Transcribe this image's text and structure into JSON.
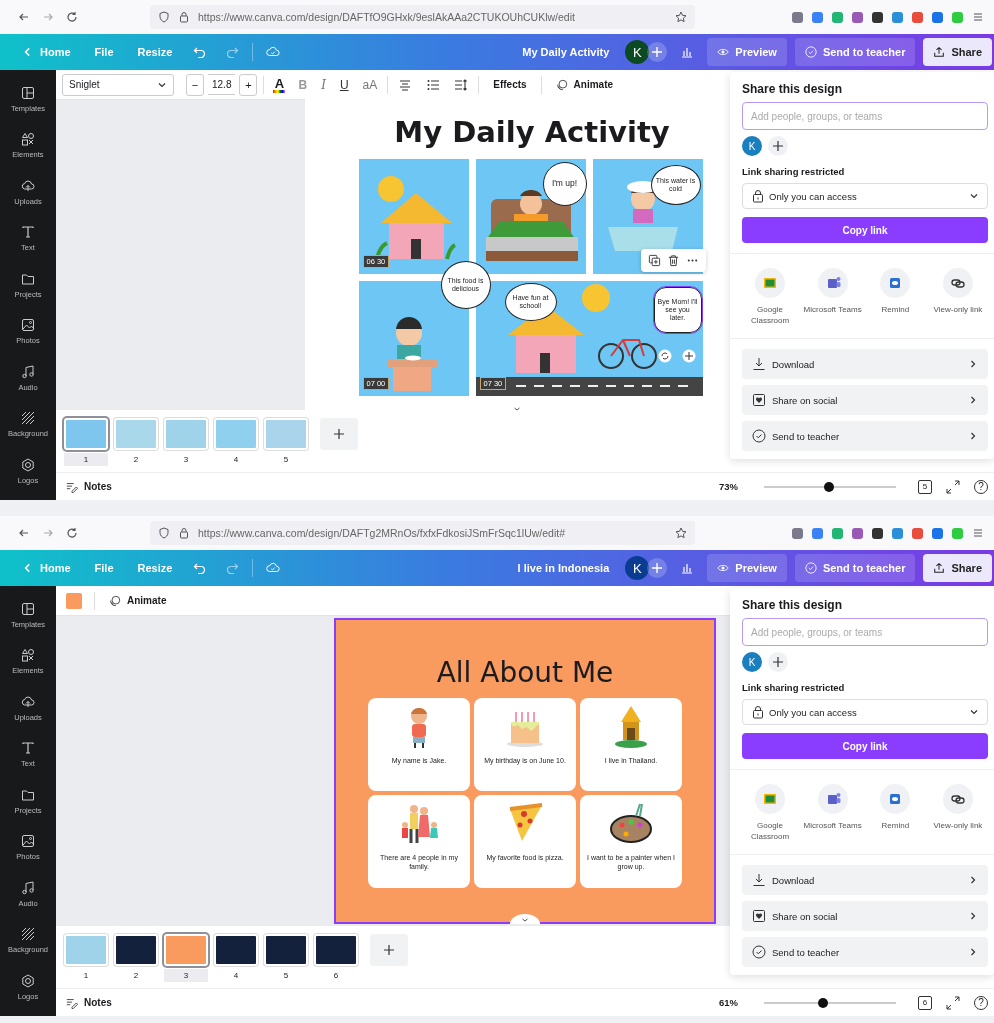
{
  "screens": [
    {
      "browser": {
        "url": "https://www.canva.com/design/DAFTfO9GHxk/9eslAkAAa2CTUKOUhCUKlw/edit"
      },
      "topbar": {
        "home": "Home",
        "file": "File",
        "resize": "Resize",
        "design_title": "My Daily Activity",
        "avatar": {
          "initial": "K",
          "color": "#0b4a22"
        },
        "preview": "Preview",
        "send": "Send to teacher",
        "share": "Share"
      },
      "sidebar": [
        {
          "kind": "templates",
          "label": "Templates"
        },
        {
          "kind": "elements",
          "label": "Elements"
        },
        {
          "kind": "uploads",
          "label": "Uploads"
        },
        {
          "kind": "text",
          "label": "Text"
        },
        {
          "kind": "projects",
          "label": "Projects"
        },
        {
          "kind": "photos",
          "label": "Photos"
        },
        {
          "kind": "audio",
          "label": "Audio"
        },
        {
          "kind": "background",
          "label": "Background"
        },
        {
          "kind": "logos",
          "label": "Logos"
        }
      ],
      "toolbar": [
        {
          "kind": "font",
          "label": "Sniglet"
        },
        {
          "kind": "minus",
          "label": "−"
        },
        {
          "kind": "size",
          "label": "12.8"
        },
        {
          "kind": "plus",
          "label": "+"
        },
        {
          "kind": "text-color",
          "label": "A"
        },
        {
          "kind": "bold",
          "label": "B"
        },
        {
          "kind": "italic",
          "label": "I"
        },
        {
          "kind": "underline",
          "label": "U"
        },
        {
          "kind": "case",
          "label": "aA"
        },
        {
          "kind": "align"
        },
        {
          "kind": "list"
        },
        {
          "kind": "spacing"
        },
        {
          "kind": "effects",
          "label": "Effects"
        },
        {
          "kind": "animate",
          "label": "Animate"
        }
      ],
      "design": {
        "kind": "comic",
        "selected": false,
        "title": "My Daily Activity",
        "panels": [
          {
            "kind": "house",
            "time": "06 30"
          },
          {
            "kind": "bed",
            "bubbles": [
              {
                "text": "I'm up!",
                "selected": false
              }
            ]
          },
          {
            "kind": "bath",
            "bubbles": [
              {
                "text": "This water is cold",
                "selected": false
              }
            ]
          },
          {
            "kind": "meal",
            "time": "07 00",
            "bubbles": [
              {
                "text": "This food is delicious",
                "selected": false
              }
            ]
          },
          {
            "kind": "street",
            "time": "07 30",
            "bubbles": [
              {
                "text": "Have fun at school!",
                "selected": false
              },
              {
                "text": "Bye Mom! I'll see you later.",
                "selected": true
              }
            ]
          }
        ]
      },
      "thumbnails": [
        {
          "number": "1",
          "color": "#7fc6ee",
          "selected": true
        },
        {
          "number": "2",
          "color": "#a8d8ea",
          "selected": false
        },
        {
          "number": "3",
          "color": "#9fd3ea",
          "selected": false
        },
        {
          "number": "4",
          "color": "#8fd0ee",
          "selected": false
        },
        {
          "number": "5",
          "color": "#a9d4ec",
          "selected": false
        }
      ],
      "footer": {
        "notes": "Notes",
        "zoom": "73%",
        "level": 0.49,
        "pages": "5",
        "help": "?"
      },
      "share": {
        "title": "Share this design",
        "placeholder": "Add people, groups, or teams",
        "avatar": "K",
        "link_label": "Link sharing restricted",
        "access": "Only you can access",
        "copy": "Copy link",
        "apps": [
          {
            "kind": "classroom",
            "label": "Google Classroom"
          },
          {
            "kind": "teams",
            "label": "Microsoft Teams"
          },
          {
            "kind": "remind",
            "label": "Remind"
          },
          {
            "kind": "link",
            "label": "View-only link"
          }
        ],
        "actions": [
          {
            "kind": "download",
            "label": "Download"
          },
          {
            "kind": "social",
            "label": "Share on social"
          },
          {
            "kind": "teacher",
            "label": "Send to teacher"
          }
        ]
      }
    },
    {
      "browser": {
        "url": "https://www.canva.com/design/DAFTg2MRnOs/fxfxFdkosiJSmFrSqc1lUw/edit#"
      },
      "topbar": {
        "home": "Home",
        "file": "File",
        "resize": "Resize",
        "design_title": "I live in Indonesia",
        "avatar": {
          "initial": "K",
          "color": "#0a3d91"
        },
        "preview": "Preview",
        "send": "Send to teacher",
        "share": "Share"
      },
      "sidebar": [
        {
          "kind": "templates",
          "label": "Templates"
        },
        {
          "kind": "elements",
          "label": "Elements"
        },
        {
          "kind": "uploads",
          "label": "Uploads"
        },
        {
          "kind": "text",
          "label": "Text"
        },
        {
          "kind": "projects",
          "label": "Projects"
        },
        {
          "kind": "photos",
          "label": "Photos"
        },
        {
          "kind": "audio",
          "label": "Audio"
        },
        {
          "kind": "background",
          "label": "Background"
        },
        {
          "kind": "logos",
          "label": "Logos"
        }
      ],
      "toolbar": [
        {
          "kind": "swatch",
          "color": "#f99a5e"
        },
        {
          "kind": "animate",
          "label": "Animate"
        }
      ],
      "design": {
        "kind": "cards",
        "selected": true,
        "title": "All About Me",
        "cards": [
          {
            "kind": "child",
            "caption": "My name is Jake."
          },
          {
            "kind": "cake",
            "caption": "My birthday is on June 10."
          },
          {
            "kind": "temple",
            "caption": "I live in Thailand."
          },
          {
            "kind": "family",
            "caption": "There are 4 people in my family."
          },
          {
            "kind": "pizza",
            "caption": "My favorite food is pizza."
          },
          {
            "kind": "palette",
            "caption": "I want to be a painter when I grow up."
          }
        ]
      },
      "thumbnails": [
        {
          "number": "1",
          "color": "#9fd3ea",
          "selected": false
        },
        {
          "number": "2",
          "color": "#14213d",
          "selected": false
        },
        {
          "number": "3",
          "color": "#f99a5e",
          "selected": true
        },
        {
          "number": "4",
          "color": "#14213d",
          "selected": false
        },
        {
          "number": "5",
          "color": "#14213d",
          "selected": false
        },
        {
          "number": "6",
          "color": "#14213d",
          "selected": false
        }
      ],
      "footer": {
        "notes": "Notes",
        "zoom": "61%",
        "level": 0.45,
        "pages": "6",
        "help": "?"
      },
      "share": {
        "title": "Share this design",
        "placeholder": "Add people, groups, or teams",
        "avatar": "K",
        "link_label": "Link sharing restricted",
        "access": "Only you can access",
        "copy": "Copy link",
        "apps": [
          {
            "kind": "classroom",
            "label": "Google Classroom"
          },
          {
            "kind": "teams",
            "label": "Microsoft Teams"
          },
          {
            "kind": "remind",
            "label": "Remind"
          },
          {
            "kind": "link",
            "label": "View-only link"
          }
        ],
        "actions": [
          {
            "kind": "download",
            "label": "Download"
          },
          {
            "kind": "social",
            "label": "Share on social"
          },
          {
            "kind": "teacher",
            "label": "Send to teacher"
          }
        ]
      }
    }
  ]
}
